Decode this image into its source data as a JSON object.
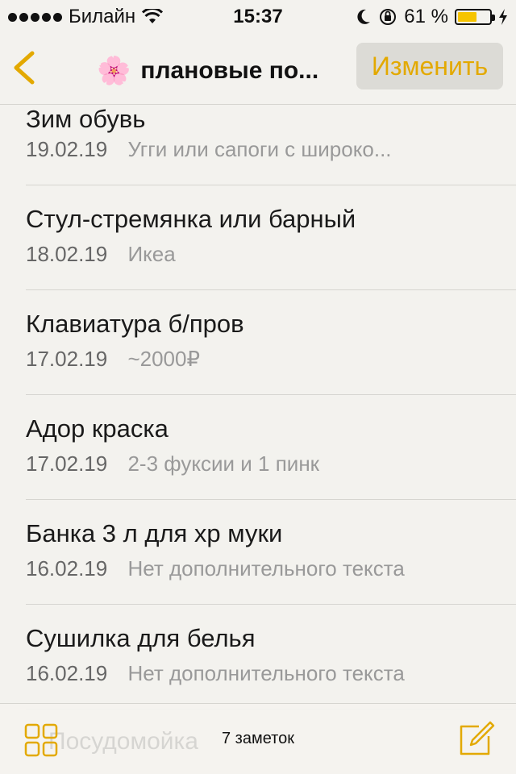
{
  "status_bar": {
    "carrier": "Билайн",
    "time": "15:37",
    "battery_percent": "61 %",
    "battery_level": 0.61
  },
  "nav": {
    "title": "плановые по...",
    "edit_label": "Изменить",
    "accent_color": "#e3a900"
  },
  "notes": [
    {
      "title": "Зим обувь",
      "date": "19.02.19",
      "preview": "Угги или сапоги с широко..."
    },
    {
      "title": "Стул-стремянка или барный",
      "date": "18.02.19",
      "preview": "Икеа"
    },
    {
      "title": "Клавиатура б/пров",
      "date": "17.02.19",
      "preview": "~2000₽"
    },
    {
      "title": "Адор краска",
      "date": "17.02.19",
      "preview": "2-3 фуксии и 1 пинк"
    },
    {
      "title": "Банка 3 л для хр муки",
      "date": "16.02.19",
      "preview": "Нет дополнительного текста"
    },
    {
      "title": "Сушилка для белья",
      "date": "16.02.19",
      "preview": "Нет дополнительного текста"
    }
  ],
  "toolbar": {
    "ghost_title": "Посудомойка",
    "notes_count": "7 заметок"
  },
  "icons": {
    "back": "chevron-left-icon",
    "flower": "cherry-blossom-icon",
    "grid": "grid-icon",
    "compose": "compose-icon"
  }
}
